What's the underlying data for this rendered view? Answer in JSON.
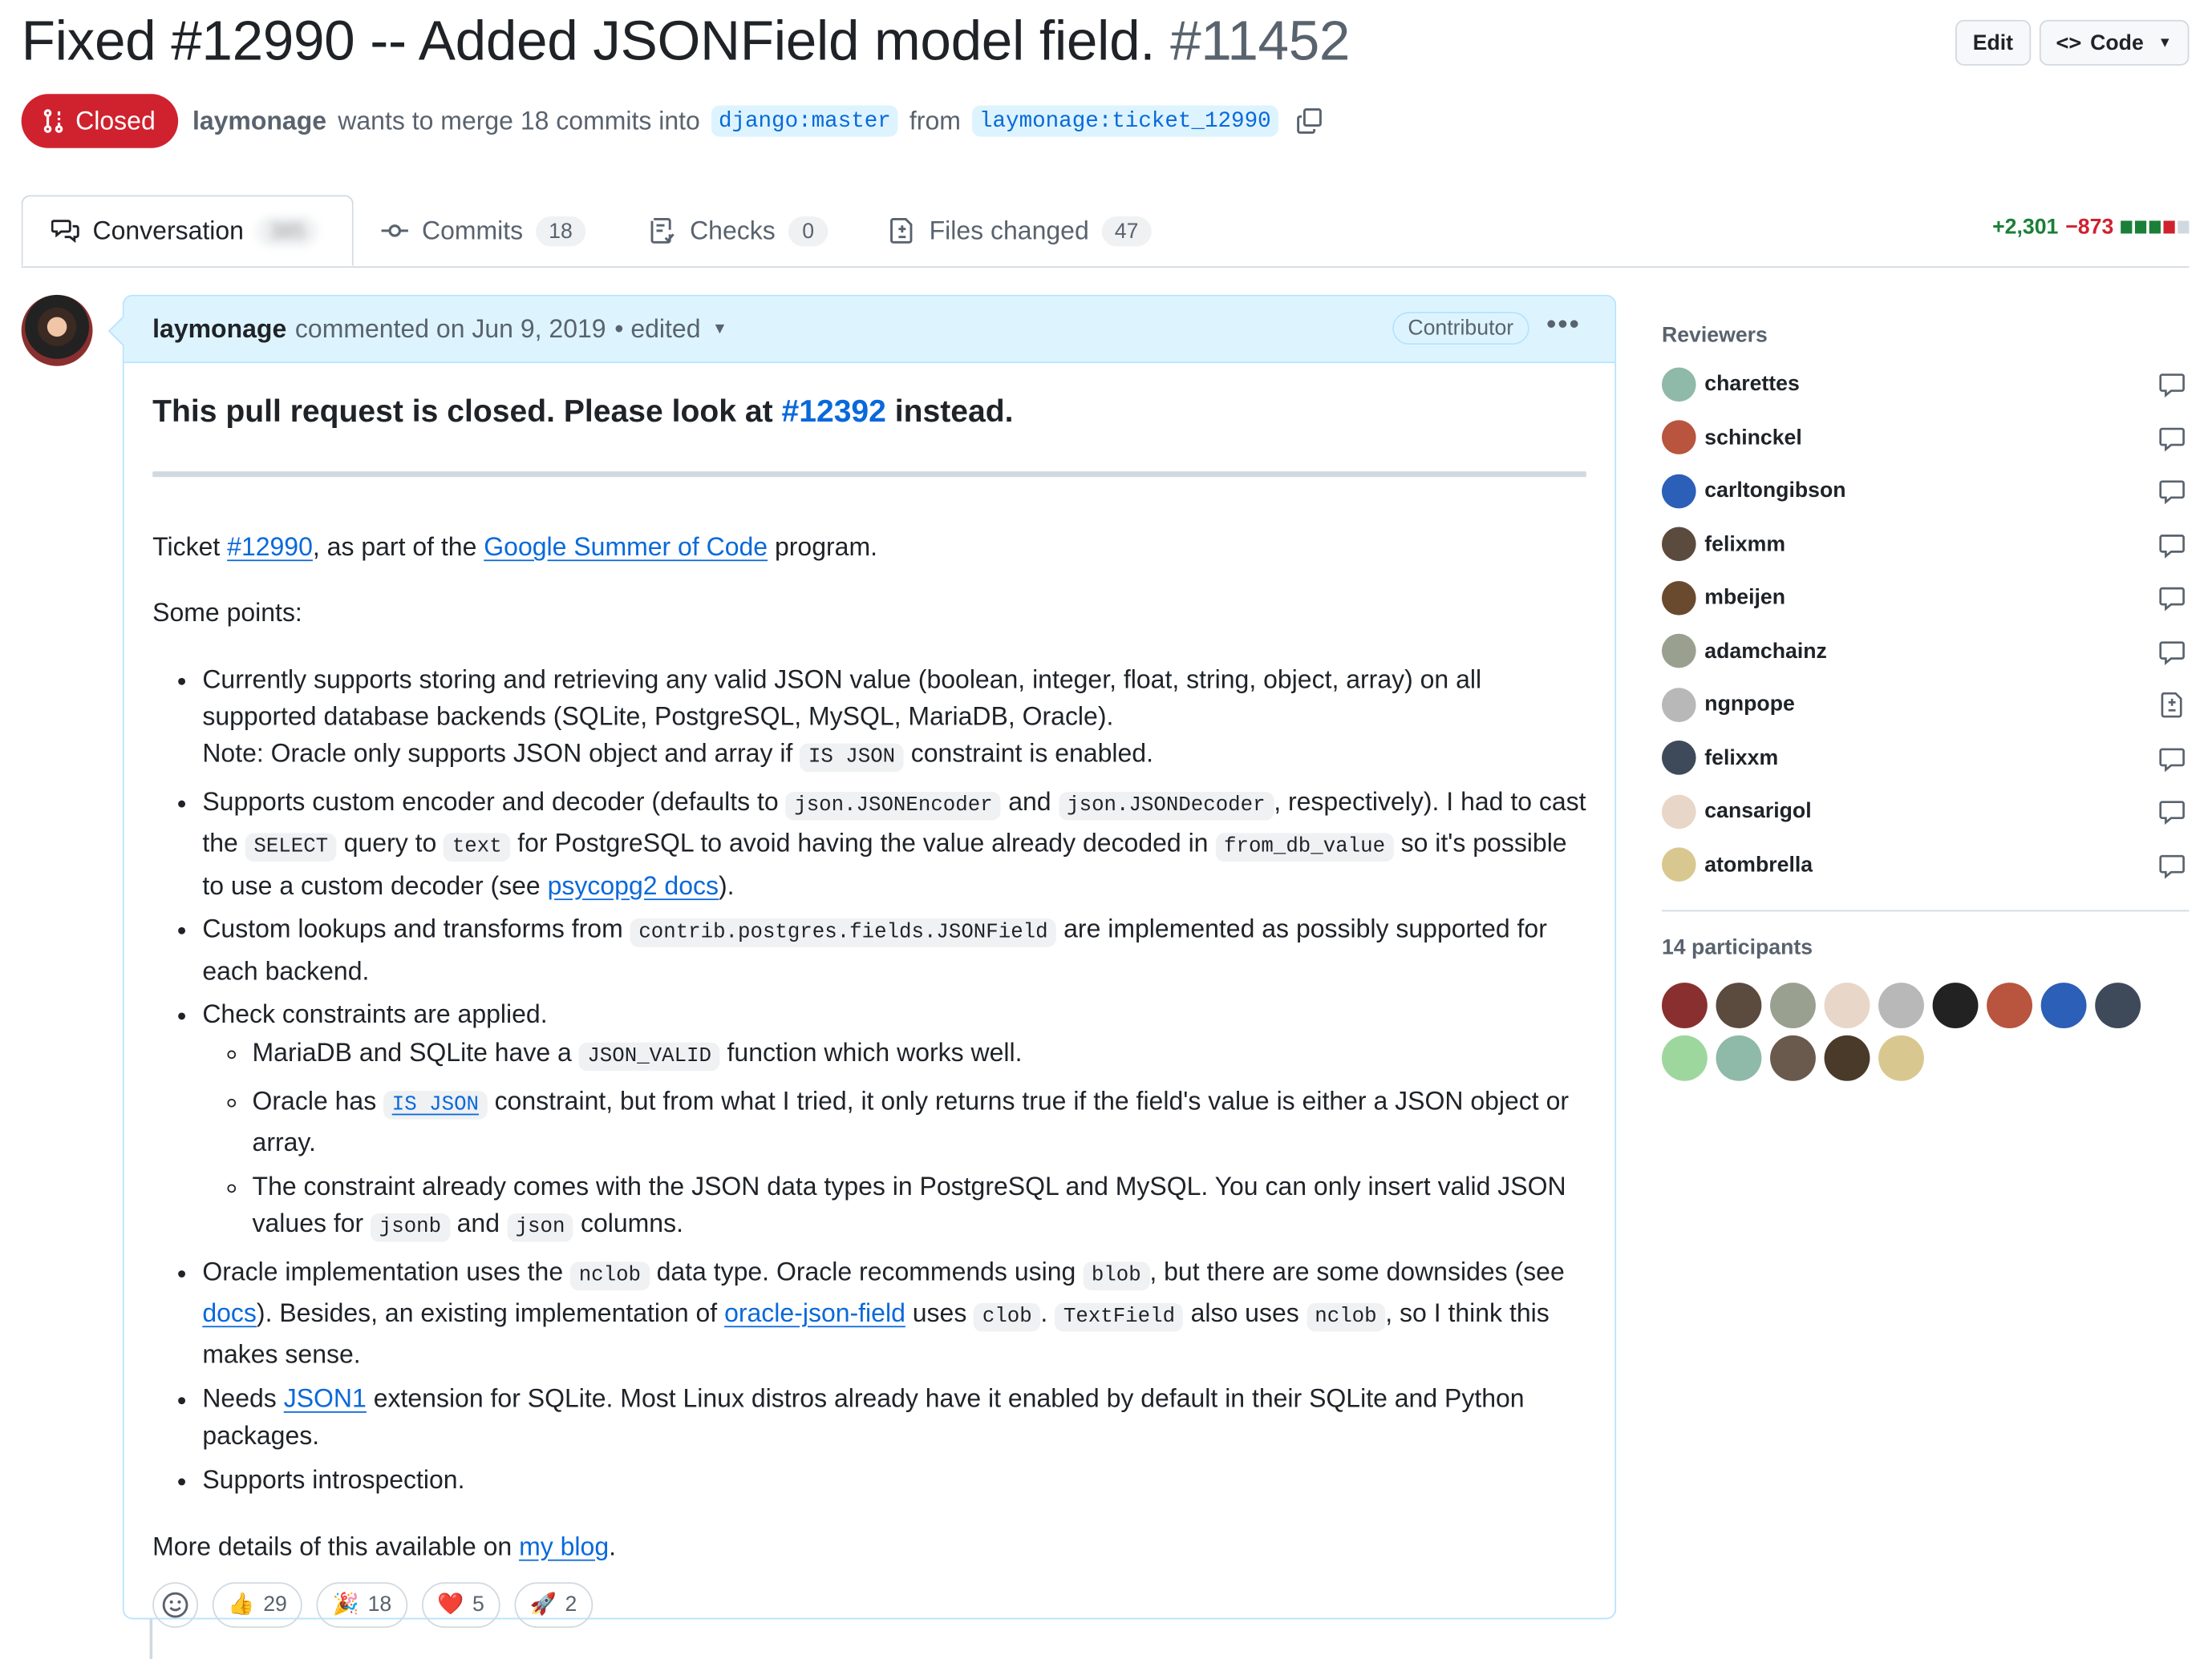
{
  "header": {
    "title": "Fixed #12990 -- Added JSONField model field.",
    "number": "#11452",
    "edit_label": "Edit",
    "code_label": "Code"
  },
  "meta": {
    "state": "Closed",
    "author": "laymonage",
    "text1": "wants to merge 18 commits into",
    "base": "django:master",
    "text2": "from",
    "head": "laymonage:ticket_12990"
  },
  "tabs": [
    {
      "label": "Conversation",
      "count": "385"
    },
    {
      "label": "Commits",
      "count": "18"
    },
    {
      "label": "Checks",
      "count": "0"
    },
    {
      "label": "Files changed",
      "count": "47"
    }
  ],
  "diffstat": {
    "additions": "+2,301",
    "deletions": "−873",
    "colors": {
      "add": "#1a7f37",
      "del": "#cf222e",
      "neutral": "#d1d9e0"
    }
  },
  "comment": {
    "author": "laymonage",
    "when": "commented on Jun 9, 2019",
    "edited": "• edited",
    "role": "Contributor",
    "heading_pre": "This pull request is closed. Please look at ",
    "heading_link": "#12392",
    "heading_post": " instead.",
    "p1_pre": "Ticket ",
    "p1_link1": "#12990",
    "p1_mid": ", as part of the ",
    "p1_link2": "Google Summer of Code",
    "p1_post": " program.",
    "p2": "Some points:",
    "b1_l1": "Currently supports storing and retrieving any valid JSON value (boolean, integer, float, string, object, array) on all supported database backends (SQLite, PostgreSQL, MySQL, MariaDB, Oracle).",
    "b1_l2_pre": "Note: Oracle only supports JSON object and array if ",
    "b1_code": "IS JSON",
    "b1_l2_post": " constraint is enabled.",
    "b2_t1": "Supports custom encoder and decoder (defaults to ",
    "b2_c1": "json.JSONEncoder",
    "b2_t2": " and ",
    "b2_c2": "json.JSONDecoder",
    "b2_t3": ", respectively). I had to cast the ",
    "b2_c3": "SELECT",
    "b2_t4": " query to ",
    "b2_c4": "text",
    "b2_t5": " for PostgreSQL to avoid having the value already decoded in ",
    "b2_c5": "from_db_value",
    "b2_t6": " so it's possible to use a custom decoder (see ",
    "b2_link": "psycopg2 docs",
    "b2_t7": ").",
    "b3_t1": "Custom lookups and transforms from ",
    "b3_c1": "contrib.postgres.fields.JSONField",
    "b3_t2": " are implemented as possibly supported for each backend.",
    "b4": "Check constraints are applied.",
    "b4a_t1": "MariaDB and SQLite have a ",
    "b4a_c1": "JSON_VALID",
    "b4a_t2": " function which works well.",
    "b4b_t1": "Oracle has ",
    "b4b_c1": "IS JSON",
    "b4b_t2": " constraint, but from what I tried, it only returns true if the field's value is either a JSON object or array.",
    "b4c_t1": "The constraint already comes with the JSON data types in PostgreSQL and MySQL. You can only insert valid JSON values for ",
    "b4c_c1": "jsonb",
    "b4c_t2": " and ",
    "b4c_c2": "json",
    "b4c_t3": " columns.",
    "b5_t1": "Oracle implementation uses the ",
    "b5_c1": "nclob",
    "b5_t2": " data type. Oracle recommends using ",
    "b5_c2": "blob",
    "b5_t3": ", but there are some downsides (see ",
    "b5_l1": "docs",
    "b5_t4": "). Besides, an existing implementation of ",
    "b5_l2": "oracle-json-field",
    "b5_t5": " uses ",
    "b5_c3": "clob",
    "b5_t6": ". ",
    "b5_c4": "TextField",
    "b5_t7": " also uses ",
    "b5_c5": "nclob",
    "b5_t8": ", so I think this makes sense.",
    "b6_t1": "Needs ",
    "b6_l1": "JSON1",
    "b6_t2": " extension for SQLite. Most Linux distros already have it enabled by default in their SQLite and Python packages.",
    "b7": "Supports introspection.",
    "p3_pre": "More details of this available on ",
    "p3_link": "my blog",
    "p3_post": "."
  },
  "reactions": [
    {
      "emoji": "👍",
      "count": "29"
    },
    {
      "emoji": "🎉",
      "count": "18"
    },
    {
      "emoji": "❤️",
      "count": "5"
    },
    {
      "emoji": "🚀",
      "count": "2"
    }
  ],
  "sidebar": {
    "reviewers_label": "Reviewers",
    "reviewers": [
      {
        "name": "charettes",
        "icon": "comment-icon",
        "color": "#8fb9a8"
      },
      {
        "name": "schinckel",
        "icon": "comment-icon",
        "color": "#b9543e"
      },
      {
        "name": "carltongibson",
        "icon": "comment-icon",
        "color": "#2b5fb8"
      },
      {
        "name": "felixmm",
        "icon": "comment-icon",
        "color": "#5b4a3e"
      },
      {
        "name": "mbeijen",
        "icon": "comment-icon",
        "color": "#6a4a2e"
      },
      {
        "name": "adamchainz",
        "icon": "comment-icon",
        "color": "#9aa090"
      },
      {
        "name": "ngnpope",
        "icon": "file-diff-icon",
        "color": "#b8b8b8"
      },
      {
        "name": "felixxm",
        "icon": "comment-icon",
        "color": "#3e4a5a"
      },
      {
        "name": "cansarigol",
        "icon": "comment-icon",
        "color": "#e8d6c8"
      },
      {
        "name": "atombrella",
        "icon": "comment-icon",
        "color": "#d8c890"
      }
    ],
    "participants_label": "14 participants",
    "participant_colors": [
      "#8a2f2f",
      "#5b4a3e",
      "#9aa090",
      "#e8d6c8",
      "#b8b8b8",
      "#222222",
      "#b9543e",
      "#2b5fb8",
      "#3e4a5a",
      "#9ed79e",
      "#8fb9a8",
      "#6a5a4e",
      "#4a3a2a",
      "#d8c890"
    ]
  }
}
